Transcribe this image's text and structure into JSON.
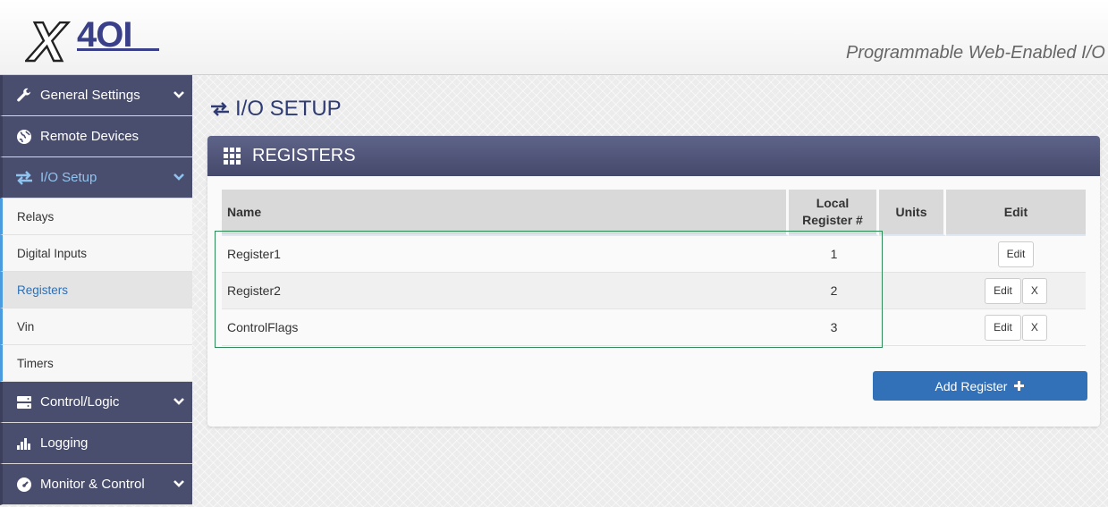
{
  "header": {
    "logo_text": "X4OI",
    "tagline": "Programmable Web-Enabled I/O"
  },
  "sidebar": {
    "items": [
      {
        "label": "General Settings",
        "icon": "wrench-icon",
        "expandable": true
      },
      {
        "label": "Remote Devices",
        "icon": "globe-icon",
        "expandable": false
      },
      {
        "label": "I/O Setup",
        "icon": "arrows-exchange-icon",
        "expandable": true,
        "active": true
      },
      {
        "label": "Relays"
      },
      {
        "label": "Digital Inputs"
      },
      {
        "label": "Registers",
        "active": true
      },
      {
        "label": "Vin"
      },
      {
        "label": "Timers"
      },
      {
        "label": "Control/Logic",
        "icon": "server-icon",
        "expandable": true
      },
      {
        "label": "Logging",
        "icon": "bar-chart-icon",
        "expandable": false
      },
      {
        "label": "Monitor & Control",
        "icon": "dashboard-icon",
        "expandable": true
      }
    ]
  },
  "page": {
    "title": "I/O SETUP"
  },
  "panel": {
    "title": "REGISTERS",
    "columns": {
      "name": "Name",
      "local_register": "Local Register #",
      "units": "Units",
      "edit": "Edit"
    },
    "rows": [
      {
        "name": "Register1",
        "register": "1",
        "units": "",
        "edit_label": "Edit",
        "delete_label": ""
      },
      {
        "name": "Register2",
        "register": "2",
        "units": "",
        "edit_label": "Edit",
        "delete_label": "X"
      },
      {
        "name": "ControlFlags",
        "register": "3",
        "units": "",
        "edit_label": "Edit",
        "delete_label": "X"
      }
    ],
    "add_button_label": "Add Register"
  },
  "colors": {
    "sidebar_bg": "#4a4e6e",
    "accent_blue": "#3271b8",
    "title_color": "#2f3c73",
    "highlight_box": "#2e8b57"
  }
}
